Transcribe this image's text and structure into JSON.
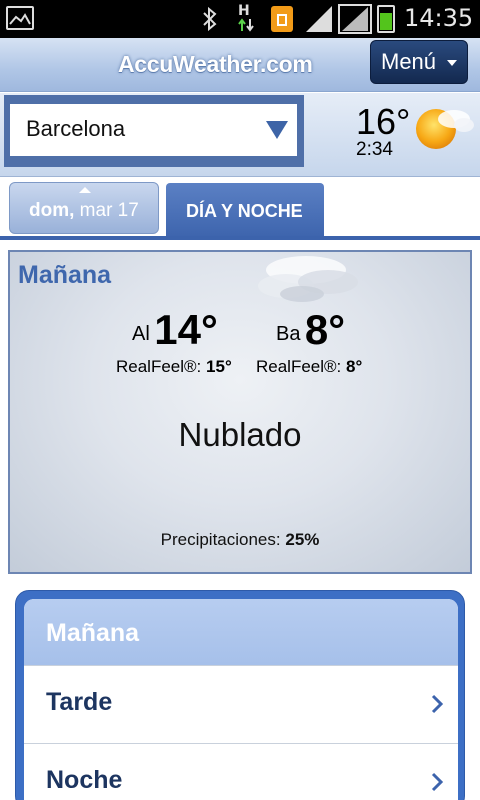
{
  "status_bar": {
    "time": "14:35",
    "network_label": "H",
    "colors": {
      "battery": "#53c41c",
      "sim": "#f29b18"
    },
    "icons": [
      "gallery-icon",
      "bluetooth-icon",
      "data-transfer-icon",
      "sim-card-icon",
      "signal-icon",
      "signal-icon-2",
      "battery-icon"
    ]
  },
  "header": {
    "logo": "AccuWeather.com",
    "menu_label": "Menú"
  },
  "location": {
    "name": "Barcelona",
    "current_temp": "16°",
    "local_time": "2:34",
    "weather_icon": "partly-sunny-icon"
  },
  "tabs": {
    "date_day": "dom,",
    "date_rest": " mar 17",
    "day_night_label": "DÍA Y NOCHE"
  },
  "forecast": {
    "period_title": "Mañana",
    "high_prefix": "Al",
    "high_temp": "14°",
    "low_prefix": "Ba",
    "low_temp": "8°",
    "realfeel_label": "RealFeel®:",
    "realfeel_high": "15°",
    "realfeel_low": "8°",
    "condition": "Nublado",
    "precip_label": "Precipitaciones:",
    "precip_value": "25%"
  },
  "periods": {
    "header": "Mañana",
    "items": [
      {
        "label": "Tarde"
      },
      {
        "label": "Noche"
      }
    ]
  },
  "colors": {
    "accent": "#3c63ac",
    "title_blue": "#3f67ad",
    "row_text": "#1d3560"
  }
}
